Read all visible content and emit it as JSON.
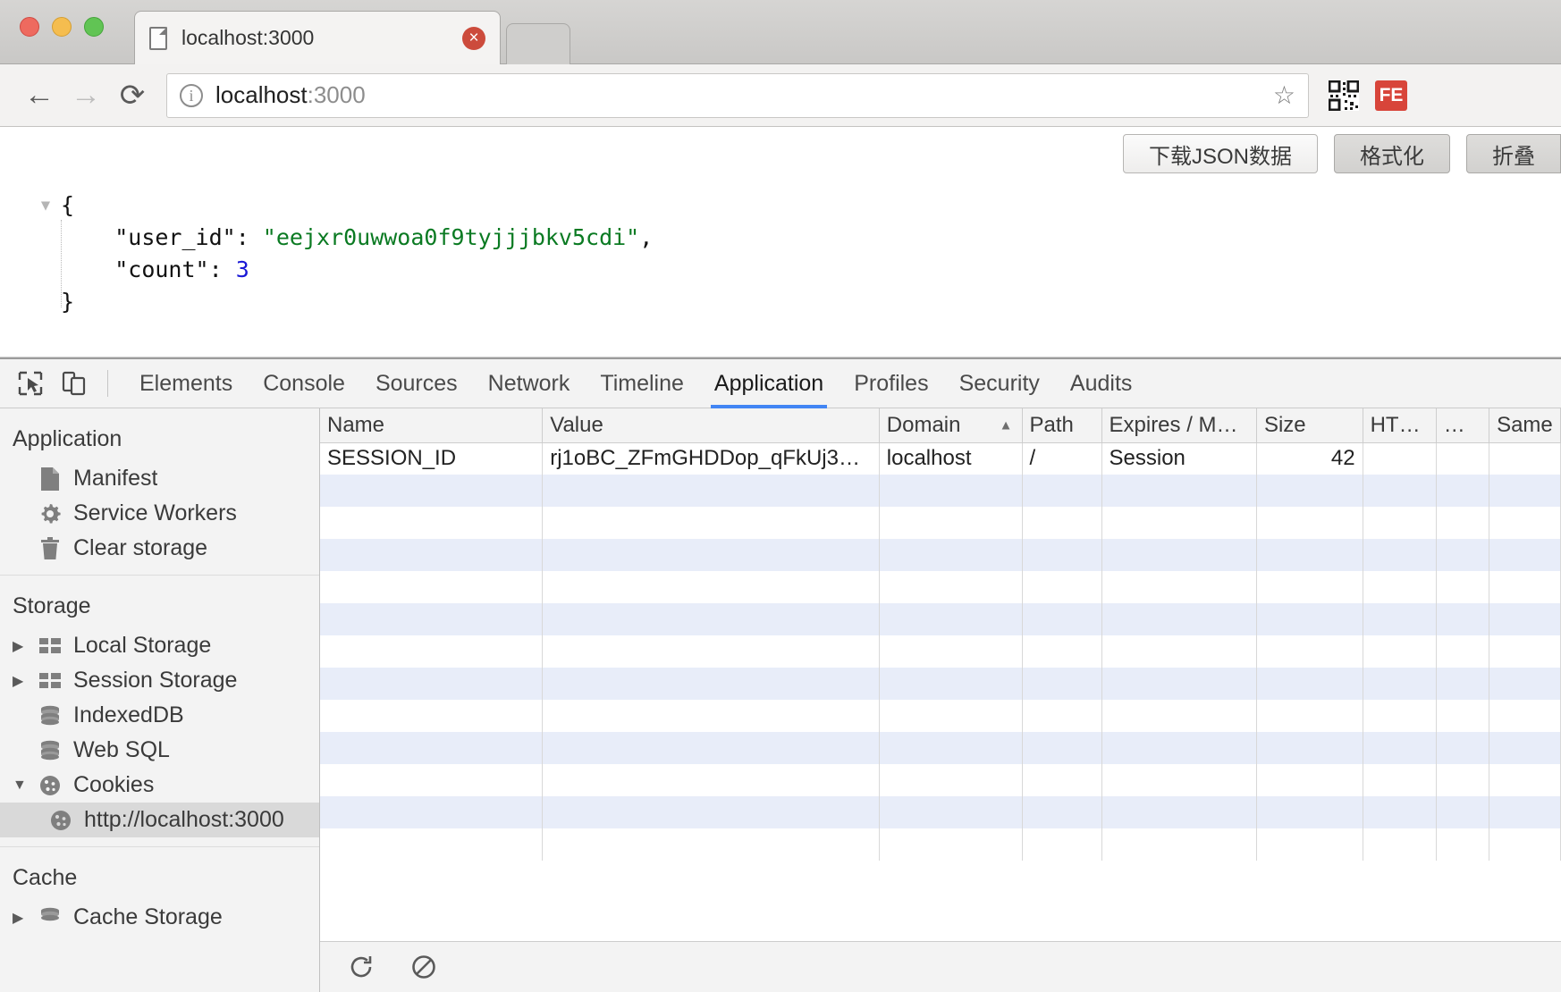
{
  "browser": {
    "tab": {
      "title": "localhost:3000",
      "favicon": "page-icon",
      "close_label": "×"
    },
    "nav": {
      "back": "←",
      "forward": "→",
      "reload": "⟳"
    },
    "omnibox": {
      "security_icon": "info-icon",
      "url_host": "localhost",
      "url_port": ":3000",
      "star": "☆"
    },
    "extensions": [
      {
        "name": "qr-code-icon",
        "label": ""
      },
      {
        "name": "fe-extension-icon",
        "label": "FE"
      }
    ]
  },
  "json_viewer": {
    "buttons": [
      {
        "id": "download",
        "label": "下载JSON数据",
        "active": false
      },
      {
        "id": "format",
        "label": "格式化",
        "active": true
      },
      {
        "id": "collapse",
        "label": "折叠",
        "active": false
      }
    ],
    "collapse_twisty": "▼",
    "lines": {
      "open_brace": "{",
      "key_user_id": "\"user_id\"",
      "colon": ": ",
      "val_user_id": "\"eejxr0uwwoa0f9tyjjjbkv5cdi\"",
      "comma": ",",
      "key_count": "\"count\"",
      "val_count": "3",
      "close_brace": "}"
    }
  },
  "devtools": {
    "inspect_icon": "cursor-select-icon",
    "device_icon": "device-toggle-icon",
    "tabs": [
      {
        "label": "Elements",
        "active": false
      },
      {
        "label": "Console",
        "active": false
      },
      {
        "label": "Sources",
        "active": false
      },
      {
        "label": "Network",
        "active": false
      },
      {
        "label": "Timeline",
        "active": false
      },
      {
        "label": "Application",
        "active": true
      },
      {
        "label": "Profiles",
        "active": false
      },
      {
        "label": "Security",
        "active": false
      },
      {
        "label": "Audits",
        "active": false
      }
    ],
    "sidebar": [
      {
        "title": "Application",
        "items": [
          {
            "label": "Manifest",
            "icon": "manifest-file-icon",
            "twisty": "",
            "indent": 1,
            "selected": false
          },
          {
            "label": "Service Workers",
            "icon": "gear-icon",
            "twisty": "",
            "indent": 1,
            "selected": false
          },
          {
            "label": "Clear storage",
            "icon": "trash-icon",
            "twisty": "",
            "indent": 1,
            "selected": false
          }
        ]
      },
      {
        "title": "Storage",
        "items": [
          {
            "label": "Local Storage",
            "icon": "table-grid-icon",
            "twisty": "▶",
            "indent": 1,
            "selected": false
          },
          {
            "label": "Session Storage",
            "icon": "table-grid-icon",
            "twisty": "▶",
            "indent": 1,
            "selected": false
          },
          {
            "label": "IndexedDB",
            "icon": "database-icon",
            "twisty": "",
            "indent": 1,
            "selected": false
          },
          {
            "label": "Web SQL",
            "icon": "database-icon",
            "twisty": "",
            "indent": 1,
            "selected": false
          },
          {
            "label": "Cookies",
            "icon": "cookie-icon",
            "twisty": "▼",
            "indent": 1,
            "selected": false
          },
          {
            "label": "http://localhost:3000",
            "icon": "cookie-icon",
            "twisty": "",
            "indent": 2,
            "selected": true
          }
        ]
      },
      {
        "title": "Cache",
        "items": [
          {
            "label": "Cache Storage",
            "icon": "database-icon",
            "twisty": "▶",
            "indent": 1,
            "selected": false
          }
        ]
      }
    ],
    "cookie_table": {
      "columns": [
        {
          "key": "name",
          "label": "Name",
          "sorted": false
        },
        {
          "key": "value",
          "label": "Value",
          "sorted": false
        },
        {
          "key": "domain",
          "label": "Domain",
          "sorted": true,
          "sort_arrow": "▲"
        },
        {
          "key": "path",
          "label": "Path",
          "sorted": false
        },
        {
          "key": "expires",
          "label": "Expires / M…",
          "sorted": false
        },
        {
          "key": "size",
          "label": "Size",
          "sorted": false
        },
        {
          "key": "http",
          "label": "HT…",
          "sorted": false
        },
        {
          "key": "secure",
          "label": "…",
          "sorted": false
        },
        {
          "key": "samesite",
          "label": "Same",
          "sorted": false
        }
      ],
      "rows": [
        {
          "name": "SESSION_ID",
          "value": "rj1oBC_ZFmGHDDop_qFkUj3…",
          "domain": "localhost",
          "path": "/",
          "expires": "Session",
          "size": "42",
          "http": "",
          "secure": "",
          "samesite": ""
        }
      ],
      "empty_row_count": 12
    },
    "bottom_toolbar": [
      {
        "name": "refresh-icon",
        "glyph": "↻"
      },
      {
        "name": "clear-icon",
        "glyph": "⊘"
      }
    ]
  }
}
